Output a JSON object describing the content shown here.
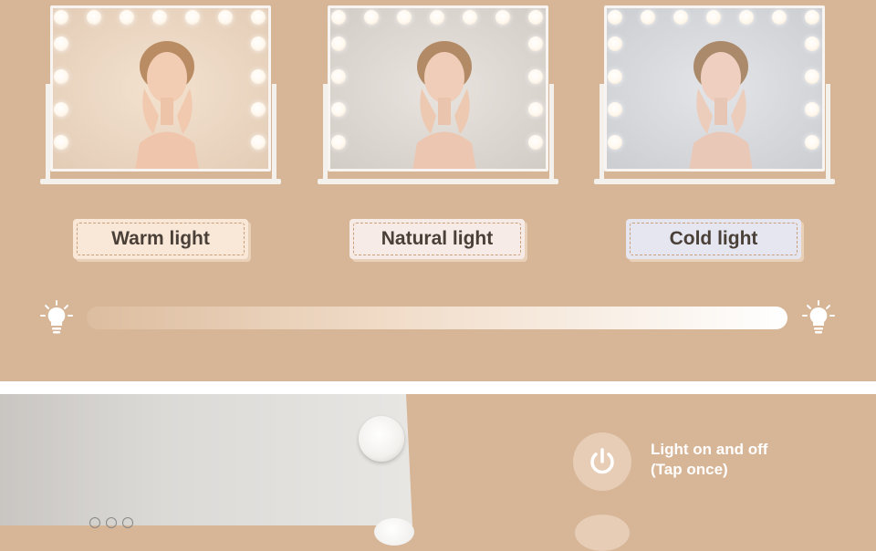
{
  "labels": {
    "warm": "Warm light",
    "natural": "Natural light",
    "cold": "Cold light"
  },
  "colors": {
    "background": "#d7b597",
    "warm_label_bg": "#f9e8d8",
    "natural_label_bg": "#f6ebe6",
    "cold_label_bg": "#e6e6f0",
    "warm_mirror": "#e8d2bd",
    "natural_mirror": "#d9d4cf",
    "cold_mirror": "#d4d6da"
  },
  "icons": {
    "left_bulb": "lightbulb-icon",
    "right_bulb": "lightbulb-icon",
    "power": "power-icon"
  },
  "control_info": {
    "line1": "Light on and off",
    "line2": "(Tap once)"
  }
}
